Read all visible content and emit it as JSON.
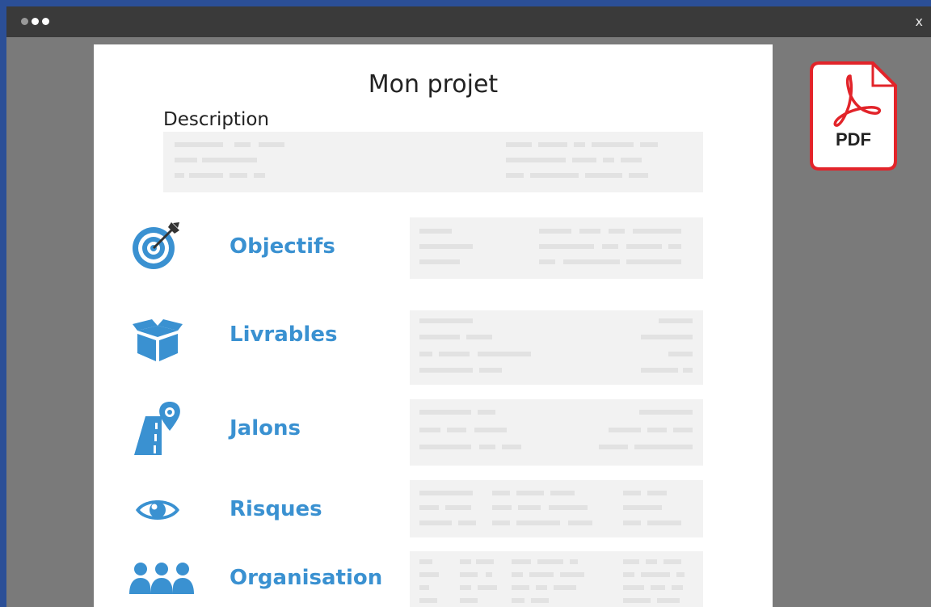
{
  "window": {
    "close_label": "x"
  },
  "document": {
    "title": "Mon projet",
    "description_label": "Description",
    "sections": [
      {
        "label": "Objectifs",
        "icon": "target-icon"
      },
      {
        "label": "Livrables",
        "icon": "box-icon"
      },
      {
        "label": "Jalons",
        "icon": "road-map-pin-icon"
      },
      {
        "label": "Risques",
        "icon": "eye-icon"
      },
      {
        "label": "Organisation",
        "icon": "people-icon"
      }
    ]
  },
  "pdf": {
    "label": "PDF",
    "icon": "acrobat-icon"
  },
  "colors": {
    "accent": "#3a91d1",
    "pdf_border": "#e2242a",
    "background": "#2b4f97",
    "window_body": "#7a7a7a",
    "titlebar": "#3a3a3a"
  }
}
